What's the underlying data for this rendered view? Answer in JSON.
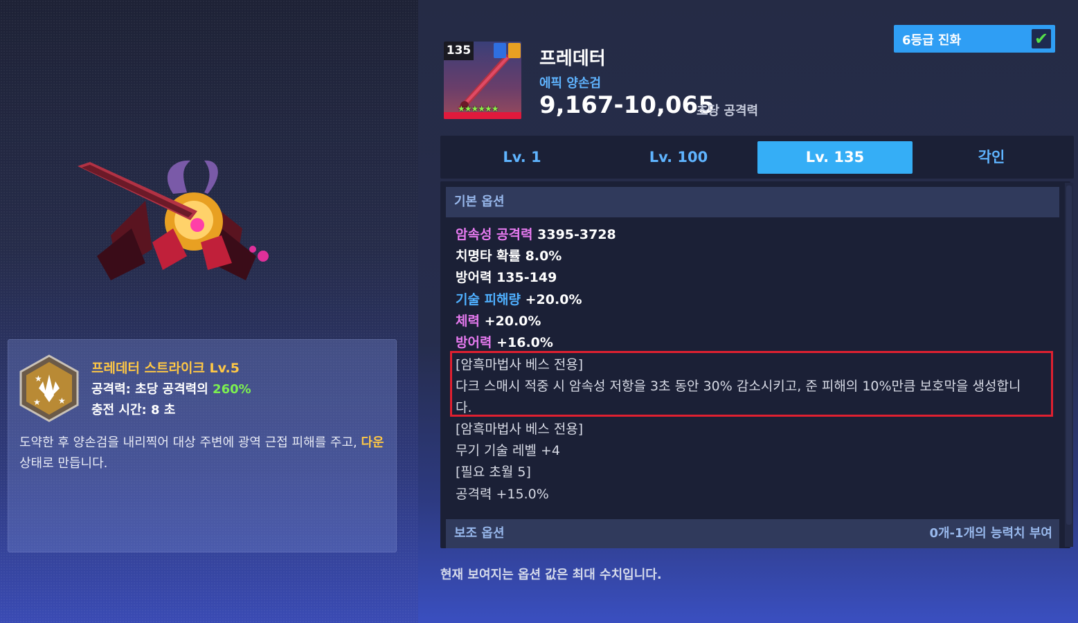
{
  "skill": {
    "title": "프레데터 스트라이크 Lv.5",
    "attack_prefix": "공격력: 초당 공격력의 ",
    "attack_value": "260%",
    "cooldown": "충전 시간: 8 초",
    "desc_part1": "도약한 후 양손검을 내리찍어 대상 주변에 광역 근접 피해를 주고, ",
    "desc_highlight": "다운",
    "desc_part2": " 상태로 만듭니다."
  },
  "item": {
    "level_badge": "135",
    "name": "프레데터",
    "type": "에픽 양손검",
    "attack_range": "9,167-10,065",
    "attack_label": "초당 공격력",
    "stars": "★★★★★★"
  },
  "evolve": {
    "label": "6등급 진화",
    "checked": true
  },
  "tabs": [
    {
      "label": "Lv. 1",
      "active": false
    },
    {
      "label": "Lv. 100",
      "active": false
    },
    {
      "label": "Lv. 135",
      "active": true
    },
    {
      "label": "각인",
      "active": false
    }
  ],
  "options": {
    "basic_header": "기본 옵션",
    "lines": [
      {
        "label": "암속성 공격력",
        "value": "3395-3728"
      },
      {
        "label": "치명타 확률",
        "value": "8.0%"
      },
      {
        "label": "방어력",
        "value": "135-149"
      },
      {
        "label": "기술 피해량",
        "value": "+20.0%"
      },
      {
        "label": "체력",
        "value": "+20.0%"
      },
      {
        "label": "방어력",
        "value": "+16.0%"
      }
    ],
    "special1_title": "[암흑마법사 베스 전용]",
    "special1_text1": "다크 스매시 적중 시 암속성 저항을 3초 동안 30% 감소시키고, 준 피해의 10%만큼 보호막을 생성합니",
    "special1_text2": "다.",
    "special2_title": "[암흑마법사 베스 전용]",
    "special2_text": "무기 기술 레벨 +4",
    "req_title": "[필요 초월 5]",
    "req_text": "공격력 +15.0%",
    "sub_header": "보조 옵션",
    "sub_right": "0개-1개의 능력치 부여"
  },
  "footnote": "현재 보여지는 옵션 값은 최대 수치입니다.",
  "colors": {
    "accent": "#35aef6",
    "highlight_border": "#e02030",
    "skill_title": "#ffc845",
    "stat_green": "#7cf050"
  }
}
